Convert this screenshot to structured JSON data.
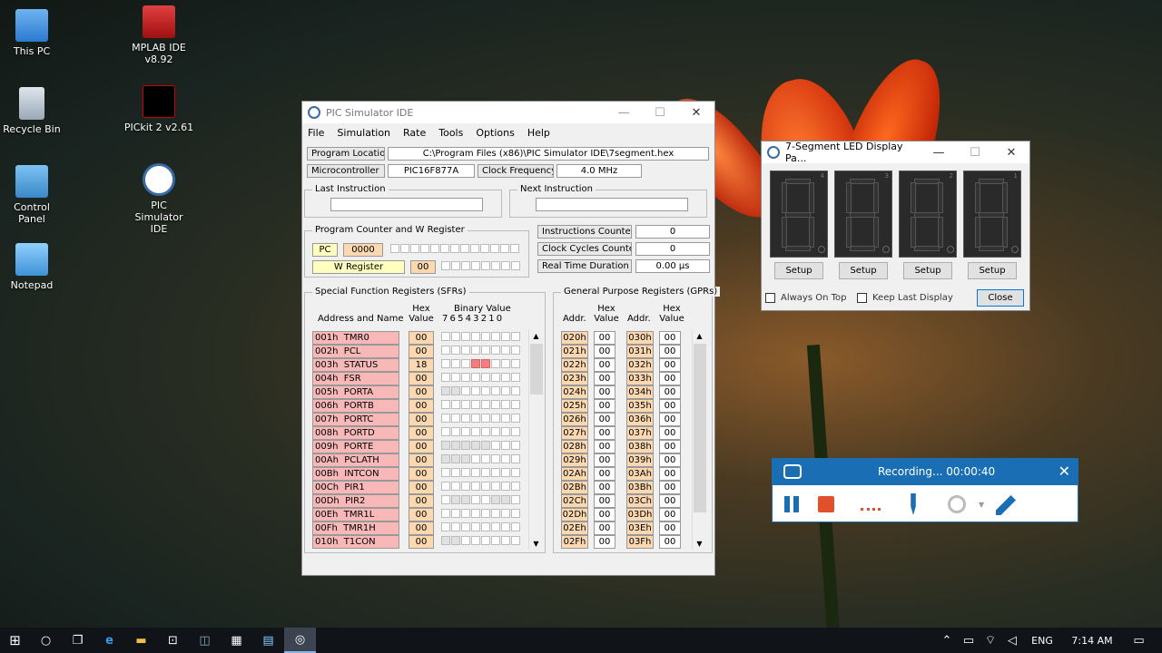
{
  "desktop": {
    "icons": [
      {
        "label": "This PC",
        "icon": "computer-icon"
      },
      {
        "label": "Recycle Bin",
        "icon": "recycle-bin-icon"
      },
      {
        "label": "Control Panel",
        "icon": "control-panel-icon"
      },
      {
        "label": "Notepad",
        "icon": "notepad-icon"
      },
      {
        "label": "MPLAB IDE v8.92",
        "icon": "mplab-icon"
      },
      {
        "label": "PICkit 2 v2.61",
        "icon": "pickit-icon"
      },
      {
        "label": "PIC Simulator IDE",
        "icon": "pic-simulator-icon"
      }
    ]
  },
  "sim": {
    "title": "PIC Simulator IDE",
    "menu": [
      "File",
      "Simulation",
      "Rate",
      "Tools",
      "Options",
      "Help"
    ],
    "program_location_label": "Program Location",
    "program_location": "C:\\Program Files (x86)\\PIC Simulator IDE\\7segment.hex",
    "microcontroller_label": "Microcontroller",
    "microcontroller": "PIC16F877A",
    "clock_label": "Clock Frequency",
    "clock": "4.0 MHz",
    "last_instruction_label": "Last Instruction",
    "next_instruction_label": "Next Instruction",
    "pcw_label": "Program Counter and W Register",
    "pc_label": "PC",
    "pc_value": "0000",
    "w_label": "W Register",
    "w_value": "00",
    "instr_counter_label": "Instructions Counter",
    "instr_counter": "0",
    "clock_cycles_label": "Clock Cycles Counter",
    "clock_cycles": "0",
    "rt_duration_label": "Real Time Duration",
    "rt_duration": "0.00 µs",
    "sfr": {
      "title": "Special Function Registers (SFRs)",
      "col_addr": "Address and Name",
      "col_hex": "Hex Value",
      "col_bin": "Binary Value",
      "bit_header": "7 6 5 4 3 2 1 0",
      "rows": [
        {
          "name": "001h  TMR0",
          "hex": "00",
          "on": [],
          "grey": []
        },
        {
          "name": "002h  PCL",
          "hex": "00",
          "on": [],
          "grey": []
        },
        {
          "name": "003h  STATUS",
          "hex": "18",
          "on": [
            3,
            4
          ],
          "grey": []
        },
        {
          "name": "004h  FSR",
          "hex": "00",
          "on": [],
          "grey": []
        },
        {
          "name": "005h  PORTA",
          "hex": "00",
          "on": [],
          "grey": [
            0,
            1
          ]
        },
        {
          "name": "006h  PORTB",
          "hex": "00",
          "on": [],
          "grey": []
        },
        {
          "name": "007h  PORTC",
          "hex": "00",
          "on": [],
          "grey": []
        },
        {
          "name": "008h  PORTD",
          "hex": "00",
          "on": [],
          "grey": []
        },
        {
          "name": "009h  PORTE",
          "hex": "00",
          "on": [],
          "grey": [
            0,
            1,
            2,
            3,
            4
          ]
        },
        {
          "name": "00Ah  PCLATH",
          "hex": "00",
          "on": [],
          "grey": [
            0,
            1,
            2
          ]
        },
        {
          "name": "00Bh  INTCON",
          "hex": "00",
          "on": [],
          "grey": []
        },
        {
          "name": "00Ch  PIR1",
          "hex": "00",
          "on": [],
          "grey": []
        },
        {
          "name": "00Dh  PIR2",
          "hex": "00",
          "on": [],
          "grey": [
            1,
            2,
            5,
            6
          ]
        },
        {
          "name": "00Eh  TMR1L",
          "hex": "00",
          "on": [],
          "grey": []
        },
        {
          "name": "00Fh  TMR1H",
          "hex": "00",
          "on": [],
          "grey": []
        },
        {
          "name": "010h  T1CON",
          "hex": "00",
          "on": [],
          "grey": [
            0,
            1
          ]
        }
      ]
    },
    "gpr": {
      "title": "General Purpose Registers (GPRs)",
      "col_addr": "Addr.",
      "col_hex": "Hex Value",
      "rows": [
        [
          "020h",
          "00",
          "030h",
          "00"
        ],
        [
          "021h",
          "00",
          "031h",
          "00"
        ],
        [
          "022h",
          "00",
          "032h",
          "00"
        ],
        [
          "023h",
          "00",
          "033h",
          "00"
        ],
        [
          "024h",
          "00",
          "034h",
          "00"
        ],
        [
          "025h",
          "00",
          "035h",
          "00"
        ],
        [
          "026h",
          "00",
          "036h",
          "00"
        ],
        [
          "027h",
          "00",
          "037h",
          "00"
        ],
        [
          "028h",
          "00",
          "038h",
          "00"
        ],
        [
          "029h",
          "00",
          "039h",
          "00"
        ],
        [
          "02Ah",
          "00",
          "03Ah",
          "00"
        ],
        [
          "02Bh",
          "00",
          "03Bh",
          "00"
        ],
        [
          "02Ch",
          "00",
          "03Ch",
          "00"
        ],
        [
          "02Dh",
          "00",
          "03Dh",
          "00"
        ],
        [
          "02Eh",
          "00",
          "03Eh",
          "00"
        ],
        [
          "02Fh",
          "00",
          "03Fh",
          "00"
        ]
      ]
    }
  },
  "seg": {
    "title": "7-Segment LED Display Pa...",
    "digit_numbers": [
      "4",
      "3",
      "2",
      "1"
    ],
    "setup_label": "Setup",
    "always_on_top": "Always On Top",
    "keep_last": "Keep Last Display",
    "close_label": "Close"
  },
  "rec": {
    "status": "Recording... 00:00:40"
  },
  "taskbar": {
    "lang": "ENG",
    "time": "7:14 AM"
  }
}
